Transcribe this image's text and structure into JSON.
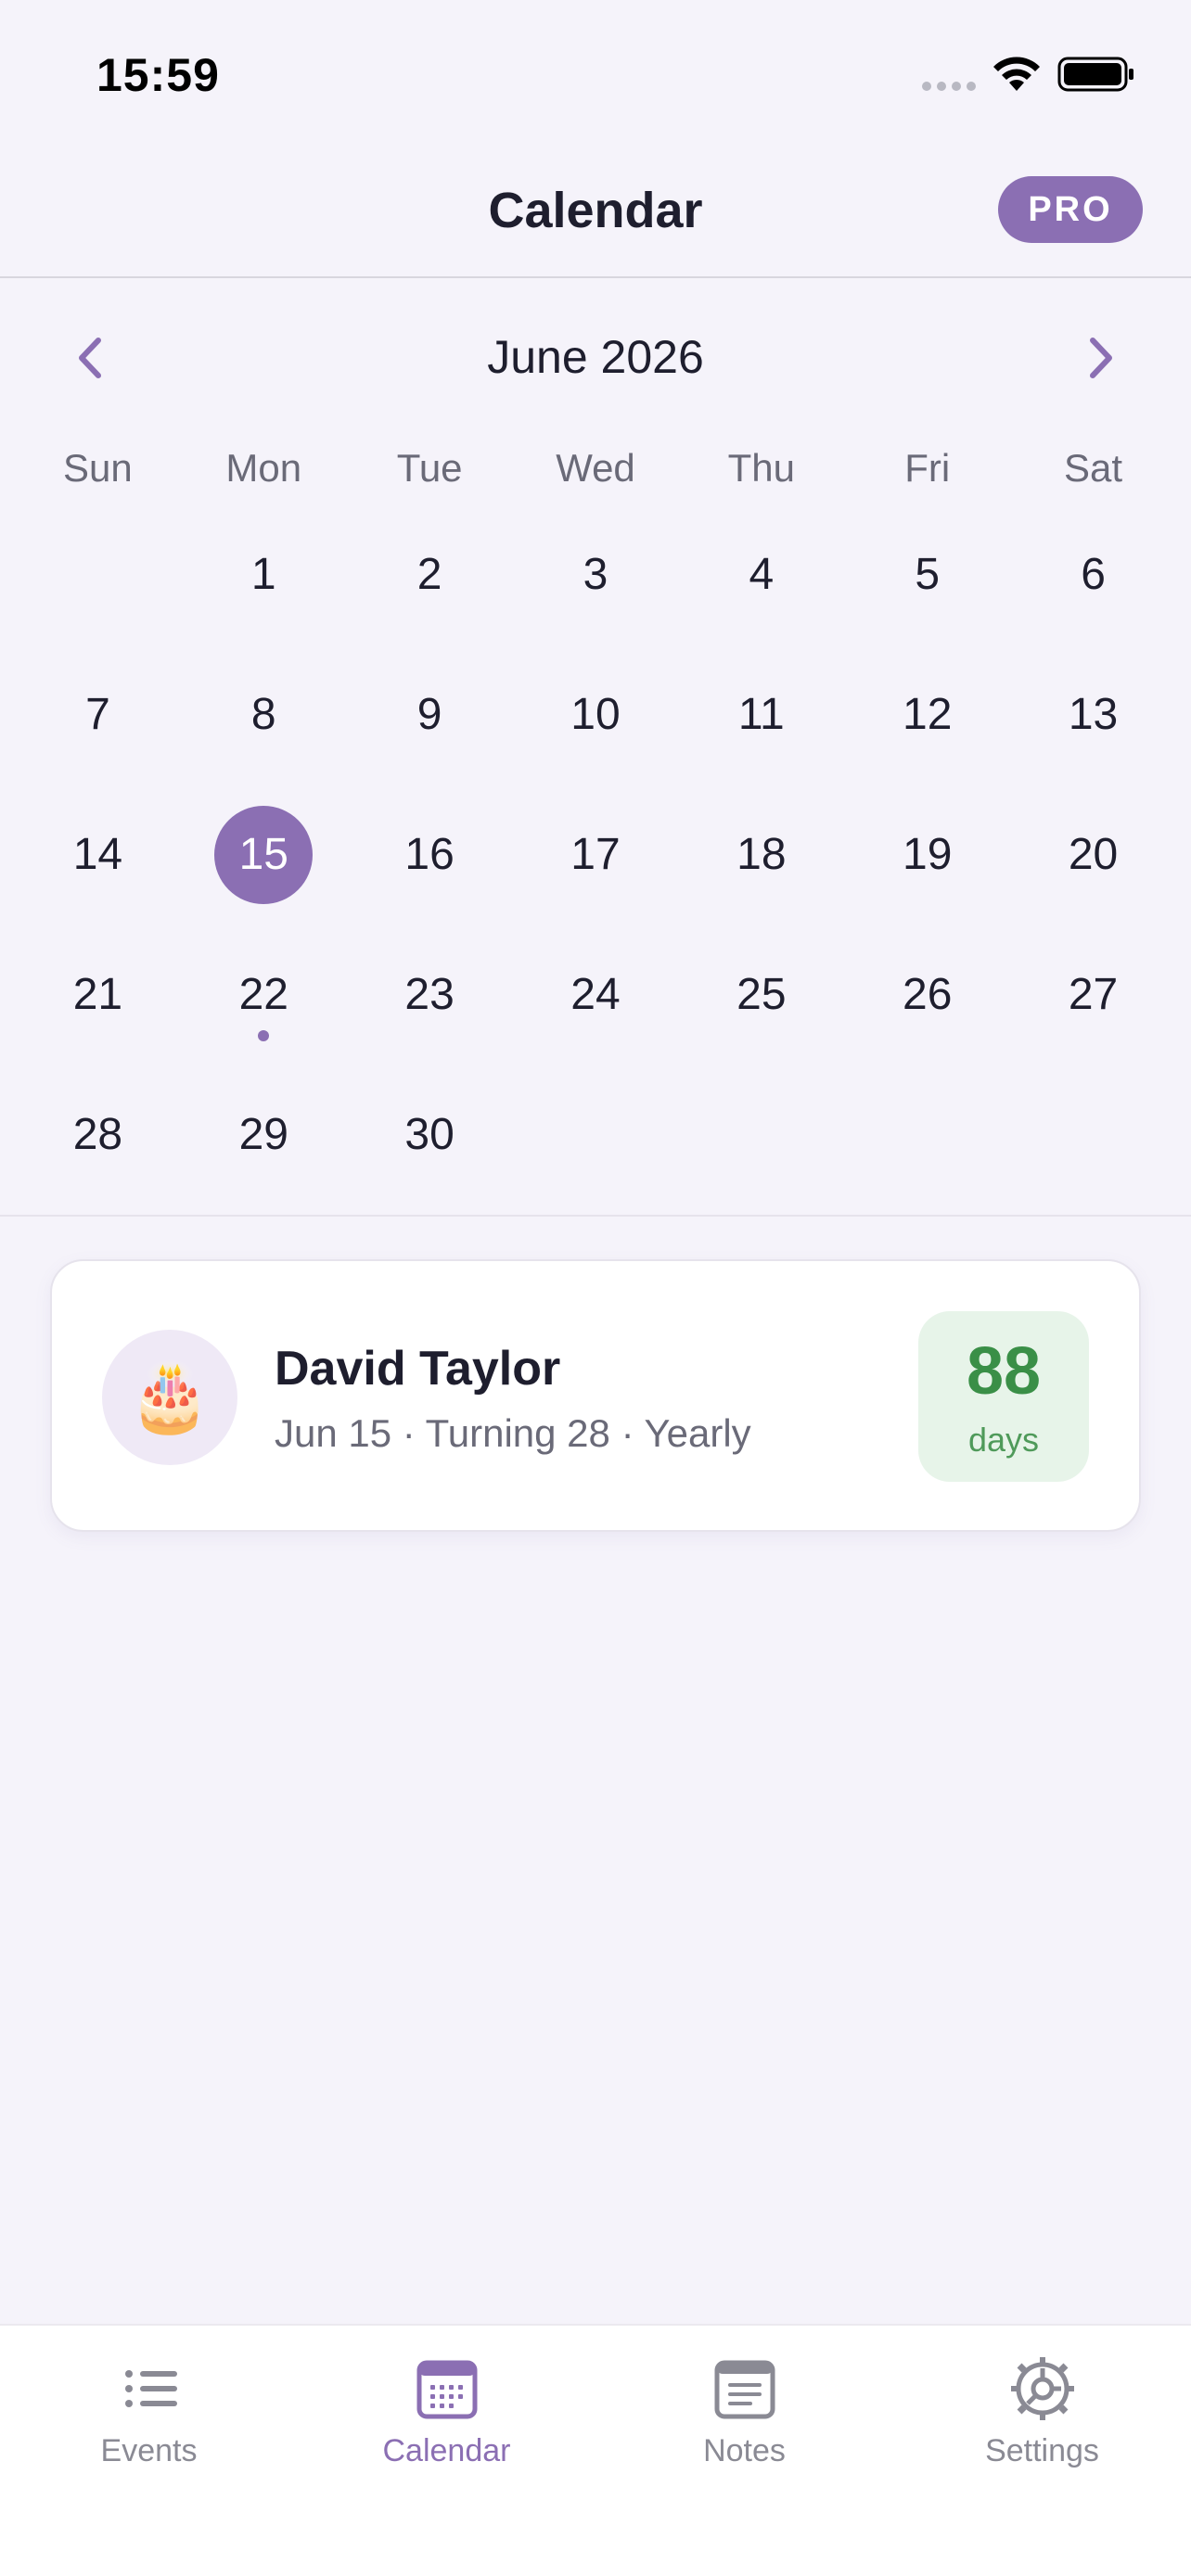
{
  "status_bar": {
    "time": "15:59"
  },
  "header": {
    "title": "Calendar",
    "pro_label": "PRO"
  },
  "calendar": {
    "month_label": "June 2026",
    "weekdays": [
      "Sun",
      "Mon",
      "Tue",
      "Wed",
      "Thu",
      "Fri",
      "Sat"
    ],
    "leading_blanks": 1,
    "days_in_month": 30,
    "selected_day": 15,
    "event_days": [
      22
    ]
  },
  "event": {
    "icon": "🎂",
    "name": "David Taylor",
    "meta": "Jun 15 · Turning 28 · Yearly",
    "days_count": "88",
    "days_unit": "days"
  },
  "tabs": [
    {
      "label": "Events",
      "icon": "list-icon",
      "active": false
    },
    {
      "label": "Calendar",
      "icon": "calendar-icon",
      "active": true
    },
    {
      "label": "Notes",
      "icon": "notes-icon",
      "active": false
    },
    {
      "label": "Settings",
      "icon": "gear-icon",
      "active": false
    }
  ],
  "colors": {
    "accent": "#8b6fb3",
    "background": "#f5f3fa",
    "days_box_bg": "#e7f4e9",
    "days_box_text": "#3a8f47",
    "tab_inactive": "#8a8a94"
  }
}
